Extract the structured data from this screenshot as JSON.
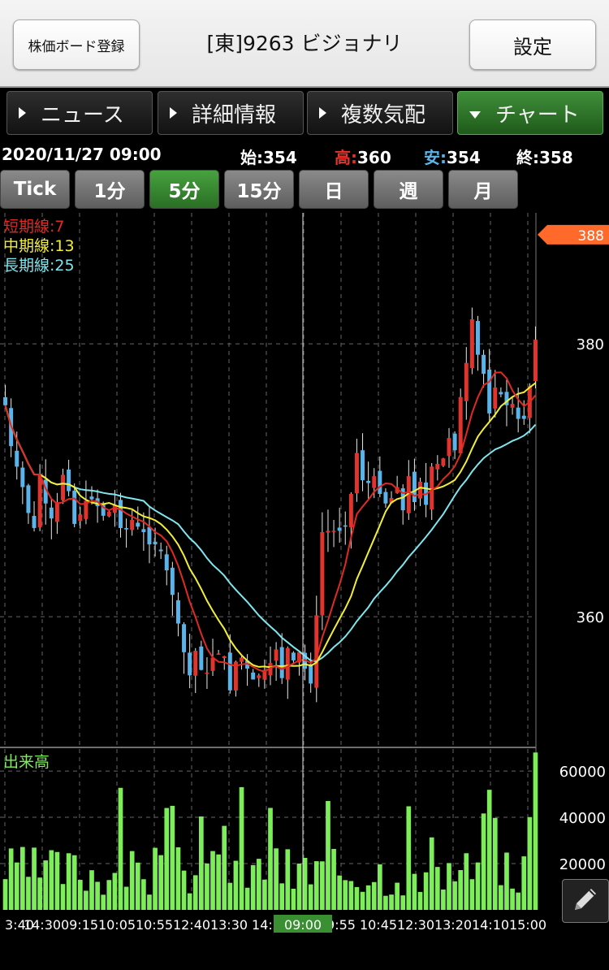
{
  "header": {
    "register_label": "株価ボード登録",
    "title": "[東]9263 ビジョナリ",
    "settings_label": "設定"
  },
  "tabs": [
    {
      "label": "ニュース",
      "active": false
    },
    {
      "label": "詳細情報",
      "active": false
    },
    {
      "label": "複数気配",
      "active": false
    },
    {
      "label": "チャート",
      "active": true
    }
  ],
  "info": {
    "datetime": "2020/11/27 09:00",
    "open_label": "始:",
    "open": "354",
    "high_label": "高:",
    "high": "360",
    "low_label": "安:",
    "low": "354",
    "close_label": "終:",
    "close": "358"
  },
  "periods": [
    {
      "label": "Tick",
      "active": false
    },
    {
      "label": "1分",
      "active": false
    },
    {
      "label": "5分",
      "active": true
    },
    {
      "label": "15分",
      "active": false
    },
    {
      "label": "日",
      "active": false
    },
    {
      "label": "週",
      "active": false
    },
    {
      "label": "月",
      "active": false
    }
  ],
  "colors": {
    "up": "#e0342d",
    "down": "#5ab4ea",
    "short_ma": "#e02a22",
    "mid_ma": "#f2ef35",
    "long_ma": "#7fe6ee",
    "volume": "#7dee5a",
    "accent": "#ff6a2a",
    "active_green": "#3a8f33"
  },
  "pencil_icon": "pencil-icon",
  "chart_data": {
    "type": "candlestick",
    "legend": [
      {
        "label": "短期線:7",
        "color": "#e02a22"
      },
      {
        "label": "中期線:13",
        "color": "#f2ef35"
      },
      {
        "label": "長期線:25",
        "color": "#7fe6ee"
      }
    ],
    "price_axis": {
      "ticks": [
        380,
        360
      ],
      "ylim": [
        350.6,
        389.6
      ],
      "current_price": 388
    },
    "volume_label": "出来高",
    "volume_axis": {
      "ticks": [
        60000,
        40000,
        20000
      ],
      "ylim": [
        0,
        69500
      ]
    },
    "x_tick_labels": [
      "3:40",
      "14:30",
      "09:15",
      "10:05",
      "10:55",
      "12:40",
      "13:30",
      "14:2",
      "09:00",
      "9:55",
      "10:45",
      "12:30",
      "13:20",
      "14:10",
      "15:00"
    ],
    "crosshair_label": "09:00",
    "grid": true,
    "close_series": [
      375.5,
      372.5,
      371.0,
      369.5,
      367.6,
      366.5,
      370.4,
      368.3,
      367.2,
      368.4,
      370.4,
      369.2,
      366.8,
      367.5,
      368.5,
      368.6,
      368.1,
      367.4,
      367.7,
      368.2,
      366.5,
      366.4,
      367.1,
      366.6,
      366.2,
      365.3,
      365.3,
      364.8,
      363.4,
      361.6,
      359.5,
      357.4,
      355.7,
      357.5,
      356.1,
      355.9,
      357.0,
      357.3,
      357.1,
      354.6,
      356.7,
      357.0,
      356.2,
      355.4,
      355.7,
      356.1,
      356.6,
      357.6,
      355.5,
      357.7,
      356.8,
      357.4,
      356.2,
      355.1,
      360.1,
      366.2,
      366.3,
      366.3,
      366.3,
      366.6,
      369.0,
      372.0,
      370.0,
      369.8,
      370.3,
      369.0,
      368.3,
      368.7,
      369.5,
      367.8,
      370.3,
      368.4,
      369.9,
      368.2,
      371.0,
      371.2,
      371.6,
      373.1,
      372.2,
      376.1,
      378.6,
      381.8,
      379.2,
      377.8,
      374.9,
      376.8,
      376.3,
      375.5,
      375.6,
      374.5,
      374.5,
      376.9,
      380.3
    ]
  }
}
